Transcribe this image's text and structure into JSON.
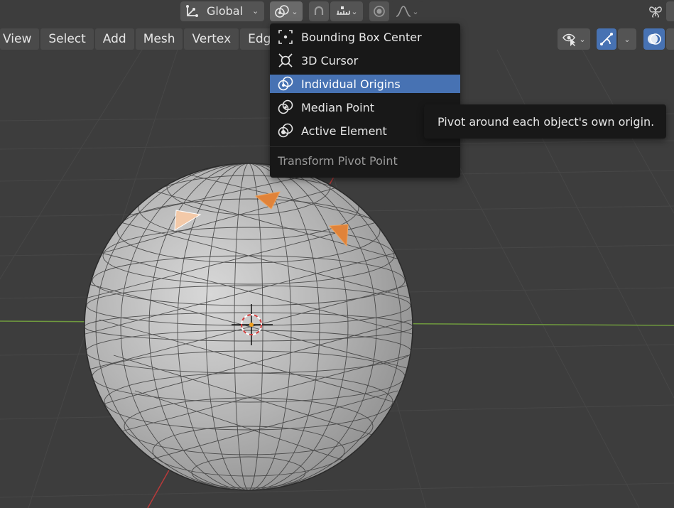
{
  "topbar": {
    "orientation_label": "Global"
  },
  "menubar": {
    "items": [
      "View",
      "Select",
      "Add",
      "Mesh",
      "Vertex",
      "Edge"
    ]
  },
  "pivot_menu": {
    "items": [
      {
        "label": "Bounding Box Center",
        "icon": "bounding-box-center-icon"
      },
      {
        "label": "3D Cursor",
        "icon": "3d-cursor-icon"
      },
      {
        "label": "Individual Origins",
        "icon": "individual-origins-icon"
      },
      {
        "label": "Median Point",
        "icon": "median-point-icon"
      },
      {
        "label": "Active Element",
        "icon": "active-element-icon"
      }
    ],
    "selected": "Individual Origins",
    "title": "Transform Pivot Point"
  },
  "tooltip": {
    "text": "Pivot around each object's own origin."
  },
  "colors": {
    "viewport_bg": "#3d3d3d",
    "grid_line": "#4a4a4a",
    "x_axis": "#b83a3a",
    "y_axis": "#6f9a3e",
    "menu_bg": "#181818",
    "highlight": "#4772b3",
    "selected_face": "#e0833a",
    "active_face": "#f3c9a8"
  }
}
